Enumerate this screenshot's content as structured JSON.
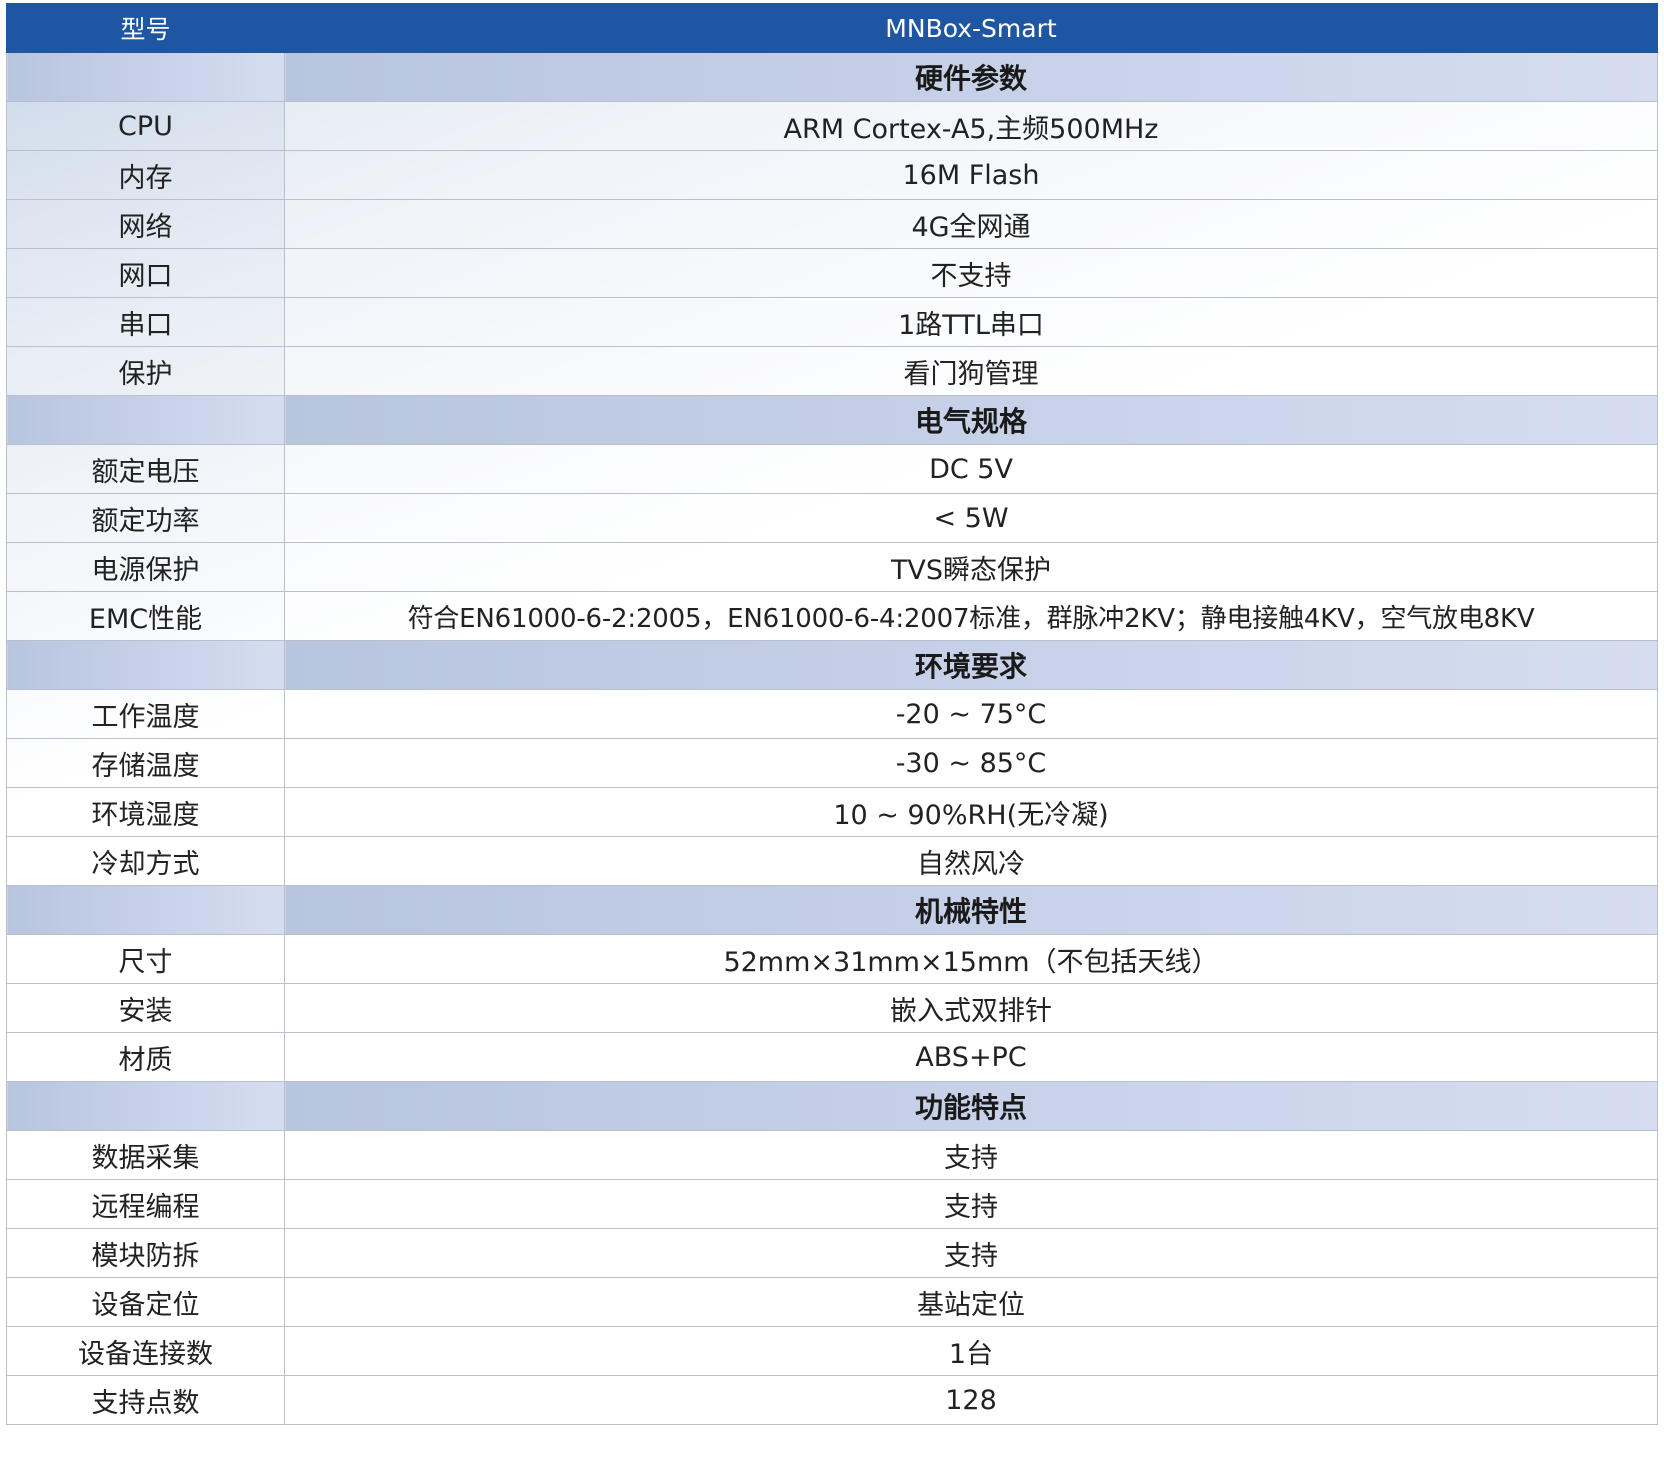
{
  "header": {
    "label": "型号",
    "value": "MNBox-Smart"
  },
  "sections": [
    {
      "title": "硬件参数",
      "rows": [
        {
          "label": "CPU",
          "value": "ARM Cortex-A5,主频500MHz"
        },
        {
          "label": "内存",
          "value": "16M Flash"
        },
        {
          "label": "网络",
          "value": "4G全网通"
        },
        {
          "label": "网口",
          "value": "不支持"
        },
        {
          "label": "串口",
          "value": "1路TTL串口"
        },
        {
          "label": "保护",
          "value": "看门狗管理"
        }
      ]
    },
    {
      "title": "电气规格",
      "rows": [
        {
          "label": "额定电压",
          "value": "DC 5V"
        },
        {
          "label": "额定功率",
          "value": "< 5W"
        },
        {
          "label": "电源保护",
          "value": "TVS瞬态保护"
        },
        {
          "label": "EMC性能",
          "value": "符合EN61000-6-2:2005，EN61000-6-4:2007标准，群脉冲2KV；静电接触4KV，空气放电8KV"
        }
      ]
    },
    {
      "title": "环境要求",
      "rows": [
        {
          "label": "工作温度",
          "value": "-20 ~ 75°C"
        },
        {
          "label": "存储温度",
          "value": "-30 ~ 85°C"
        },
        {
          "label": "环境湿度",
          "value": "10 ~ 90%RH(无冷凝)"
        },
        {
          "label": "冷却方式",
          "value": "自然风冷"
        }
      ]
    },
    {
      "title": "机械特性",
      "rows": [
        {
          "label": "尺寸",
          "value": "52mm×31mm×15mm（不包括天线）"
        },
        {
          "label": "安装",
          "value": "嵌入式双排针"
        },
        {
          "label": "材质",
          "value": "ABS+PC"
        }
      ]
    },
    {
      "title": "功能特点",
      "rows": [
        {
          "label": "数据采集",
          "value": "支持"
        },
        {
          "label": "远程编程",
          "value": "支持"
        },
        {
          "label": "模块防拆",
          "value": "支持"
        },
        {
          "label": "设备定位",
          "value": "基站定位"
        },
        {
          "label": "设备连接数",
          "value": "1台"
        },
        {
          "label": "支持点数",
          "value": "128"
        }
      ]
    }
  ],
  "colors": {
    "header_bg": "#1f56a4",
    "section_bg": "#c9d3ea",
    "border": "#b9c0cc"
  }
}
